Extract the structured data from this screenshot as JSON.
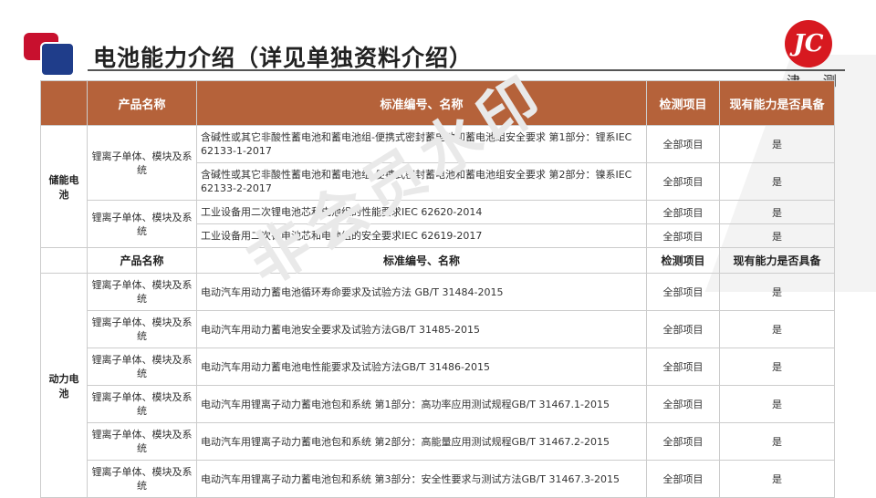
{
  "header": {
    "title": "电池能力介绍（详见单独资料介绍）",
    "logo_text": "JC",
    "logo_caption": "津 测"
  },
  "watermark": "非会员水印",
  "table": {
    "columns": [
      "",
      "产品名称",
      "标准编号、名称",
      "检测项目",
      "现有能力是否具备"
    ],
    "sub_columns": [
      "产品名称",
      "标准编号、名称",
      "检测项目",
      "现有能力是否具备"
    ],
    "storage": {
      "category": "储能电池",
      "groups": [
        {
          "product": "锂离子单体、模块及系统",
          "rows": [
            {
              "standard": "含碱性或其它非酸性蓄电池和蓄电池组-便携式密封蓄电池和蓄电池组安全要求 第1部分：锂系IEC 62133-1-2017",
              "item": "全部项目",
              "capable": "是"
            },
            {
              "standard": "含碱性或其它非酸性蓄电池和蓄电池组-便携式密封蓄电池和蓄电池组安全要求 第2部分：镍系IEC 62133-2-2017",
              "item": "全部项目",
              "capable": "是"
            }
          ]
        },
        {
          "product": "锂离子单体、模块及系统",
          "rows": [
            {
              "standard": "工业设备用二次锂电池芯和电池组的性能要求IEC 62620-2014",
              "item": "全部项目",
              "capable": "是"
            },
            {
              "standard": "工业设备用二次锂电池芯和电池组的安全要求IEC 62619-2017",
              "item": "全部项目",
              "capable": "是"
            }
          ]
        }
      ]
    },
    "power": {
      "category": "动力电池",
      "rows": [
        {
          "product": "锂离子单体、模块及系统",
          "standard": "电动汽车用动力蓄电池循环寿命要求及试验方法 GB/T 31484-2015",
          "item": "全部项目",
          "capable": "是"
        },
        {
          "product": "锂离子单体、模块及系统",
          "standard": "电动汽车用动力蓄电池安全要求及试验方法GB/T 31485-2015",
          "item": "全部项目",
          "capable": "是"
        },
        {
          "product": "锂离子单体、模块及系统",
          "standard": "电动汽车用动力蓄电池电性能要求及试验方法GB/T 31486-2015",
          "item": "全部项目",
          "capable": "是"
        },
        {
          "product": "锂离子单体、模块及系统",
          "standard": "电动汽车用锂离子动力蓄电池包和系统 第1部分：高功率应用测试规程GB/T 31467.1-2015",
          "item": "全部项目",
          "capable": "是"
        },
        {
          "product": "锂离子单体、模块及系统",
          "standard": "电动汽车用锂离子动力蓄电池包和系统 第2部分：高能量应用测试规程GB/T 31467.2-2015",
          "item": "全部项目",
          "capable": "是"
        },
        {
          "product": "锂离子单体、模块及系统",
          "standard": "电动汽车用锂离子动力蓄电池包和系统 第3部分：安全性要求与测试方法GB/T 31467.3-2015",
          "item": "全部项目",
          "capable": "是"
        }
      ]
    }
  }
}
